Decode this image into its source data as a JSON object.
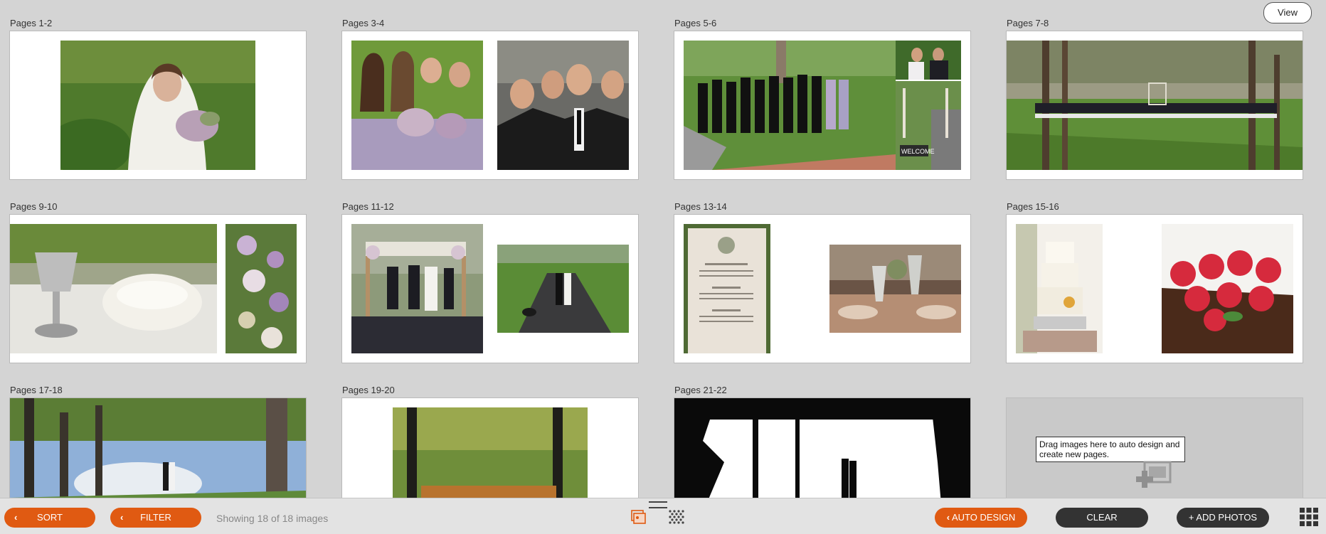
{
  "toolbar": {
    "view_label": "View"
  },
  "spreads": [
    {
      "label": "Pages 1-2"
    },
    {
      "label": "Pages 3-4"
    },
    {
      "label": "Pages 5-6"
    },
    {
      "label": "Pages 7-8"
    },
    {
      "label": "Pages 9-10"
    },
    {
      "label": "Pages 11-12"
    },
    {
      "label": "Pages 13-14"
    },
    {
      "label": "Pages 15-16"
    },
    {
      "label": "Pages 17-18"
    },
    {
      "label": "Pages 19-20"
    },
    {
      "label": "Pages 21-22"
    }
  ],
  "drop_zone": {
    "text": "Drag images here to auto design and create new pages."
  },
  "bottom_bar": {
    "sort_label": "SORT",
    "filter_label": "FILTER",
    "showing_text": "Showing 18 of 18 images",
    "auto_design_label": "AUTO DESIGN",
    "clear_label": "CLEAR",
    "add_photos_label": "+ ADD PHOTOS"
  },
  "colors": {
    "accent": "#e05a12",
    "dark": "#333333",
    "background": "#d4d4d4"
  },
  "icons": {
    "spread_view": "spread-view-icon",
    "pattern": "pattern-grid-icon",
    "grid_menu": "grid-menu-icon",
    "add_image": "add-image-icon"
  }
}
